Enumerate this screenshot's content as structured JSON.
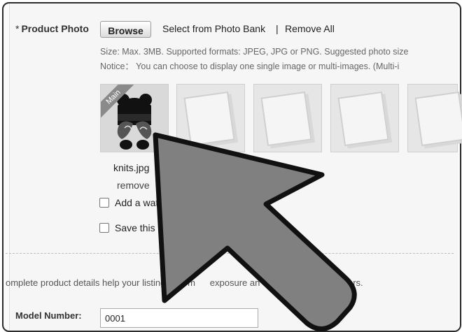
{
  "product_photo": {
    "label": "Product Photo",
    "required_mark": "*",
    "browse_label": "Browse",
    "photo_bank_link": "Select from Photo Bank",
    "separator": "|",
    "remove_all_link": "Remove All",
    "hint_size": "Size: Max. 3MB. Supported formats: JPEG, JPG or PNG. Suggested photo size",
    "hint_notice": "Notice： You can choose to display one single image or multi-images. (Multi-i",
    "main_badge": "Main",
    "file_name": "knits.jpg",
    "remove_label": "remove",
    "watermark_label": "Add a waterma",
    "save_photo_label": "Save this photo i"
  },
  "info_text": "omplete product details help your listing gain m        exposure an        ity to potential buyers.",
  "model": {
    "label": "Model Number:",
    "value": "0001"
  },
  "colors": {
    "cursor_fill": "#808080",
    "cursor_stroke": "#111111"
  }
}
